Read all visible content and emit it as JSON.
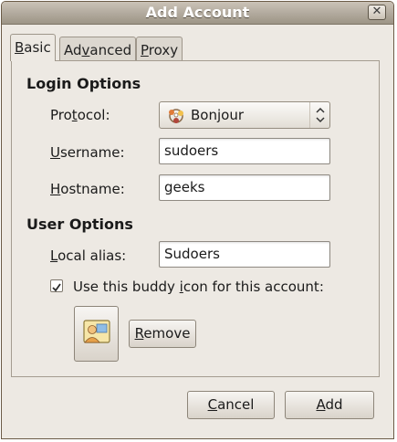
{
  "window": {
    "title": "Add Account"
  },
  "tabs": [
    {
      "label": "Basic",
      "mnemonic": "B",
      "rest": "asic"
    },
    {
      "label": "Advanced",
      "pre": "Ad",
      "mnemonic": "v",
      "rest": "anced"
    },
    {
      "label": "Proxy",
      "mnemonic": "P",
      "rest": "roxy"
    }
  ],
  "login_options": {
    "heading": "Login Options",
    "protocol_label": "Protocol:",
    "protocol_pre": "Pro",
    "protocol_mn": "t",
    "protocol_rest": "ocol:",
    "protocol_value": "Bonjour",
    "protocol_icon": "bonjour-icon",
    "username_label": "Username:",
    "username_mn": "U",
    "username_rest": "sername:",
    "username_value": "sudoers",
    "hostname_label": "Hostname:",
    "hostname_mn": "H",
    "hostname_rest": "ostname:",
    "hostname_value": "geeks"
  },
  "user_options": {
    "heading": "User Options",
    "alias_label": "Local alias:",
    "alias_mn": "L",
    "alias_rest": "ocal alias:",
    "alias_value": "Sudoers",
    "buddy_checkbox_label": "Use this buddy icon for this account:",
    "buddy_pre": "Use this buddy ",
    "buddy_mn": "i",
    "buddy_rest": "con for this account:",
    "buddy_checked": true,
    "buddy_icon": "buddy-image-icon",
    "remove_label": "Remove",
    "remove_mn": "R",
    "remove_rest": "emove"
  },
  "buttons": {
    "cancel_label": "Cancel",
    "cancel_mn": "C",
    "cancel_rest": "ancel",
    "add_label": "Add",
    "add_mn": "A",
    "add_rest": "dd"
  }
}
